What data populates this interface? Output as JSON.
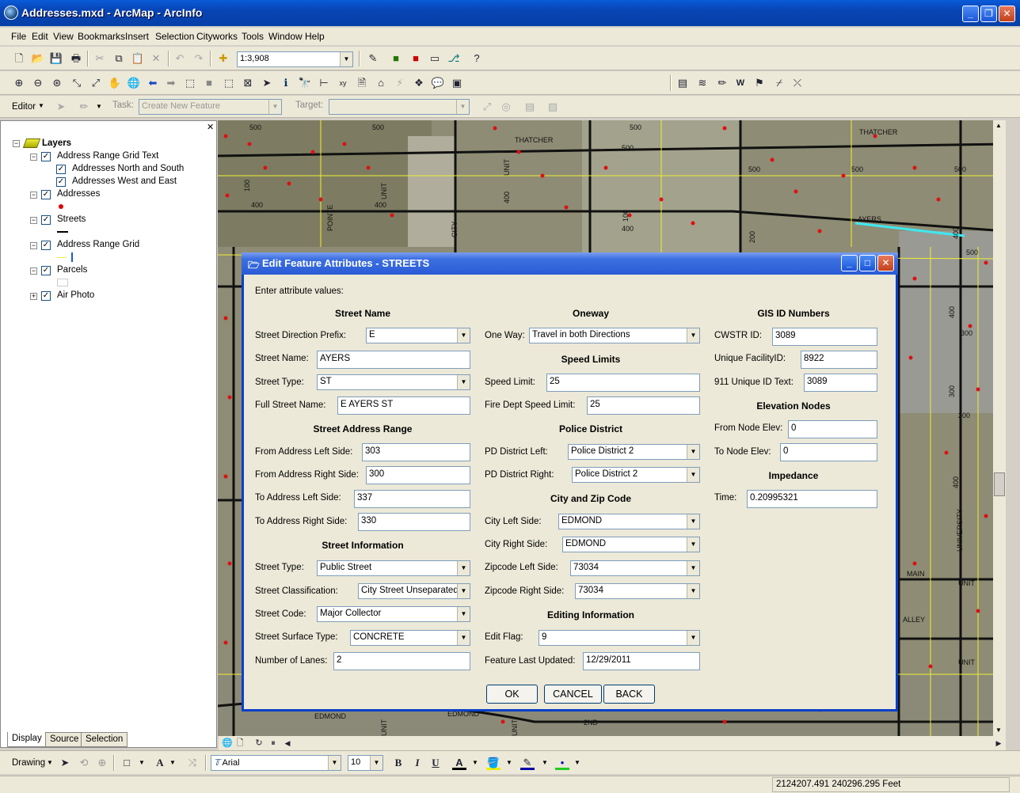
{
  "window": {
    "title": "Addresses.mxd - ArcMap - ArcInfo"
  },
  "menu": [
    "File",
    "Edit",
    "View",
    "Bookmarks",
    "Insert",
    "Selection",
    "Cityworks",
    "Tools",
    "Window",
    "Help"
  ],
  "toolbar": {
    "scale": "1:3,908"
  },
  "editor": {
    "label": "Editor",
    "task_label": "Task:",
    "task_value": "Create New Feature",
    "target_label": "Target:"
  },
  "toc": {
    "root": "Layers",
    "layers": [
      "Address Range Grid Text",
      "Addresses North and South",
      "Addresses West and East",
      "Addresses",
      "Streets",
      "Address Range Grid",
      "Parcels",
      "Air Photo"
    ],
    "tabs": [
      "Display",
      "Source",
      "Selection"
    ]
  },
  "map": {
    "labels": [
      "500",
      "500",
      "THATCHER",
      "500",
      "500",
      "THATCHER",
      "500",
      "500",
      "500",
      "400",
      "100",
      "400",
      "POINTE",
      "UNIT",
      "AYERS",
      "400",
      "400",
      "100",
      "400",
      "UNIT",
      "200",
      "500",
      "400",
      "300",
      "300",
      "200",
      "MAIN",
      "UNIT",
      "ALLEY",
      "UNIT",
      "400",
      "UNIVERSITY",
      "EDMOND",
      "EDMOND",
      "2ND",
      "UNIT",
      "UNIT",
      "CITY"
    ]
  },
  "dialog": {
    "title": "Edit Feature Attributes - STREETS",
    "intro": "Enter attribute values:",
    "col1": {
      "h_street_name": "Street Name",
      "dir_prefix_label": "Street Direction Prefix:",
      "dir_prefix": "E",
      "street_name_label": "Street Name:",
      "street_name": "AYERS",
      "street_type_label": "Street Type:",
      "street_type": "ST",
      "full_name_label": "Full Street Name:",
      "full_name": "E AYERS ST",
      "h_range": "Street Address Range",
      "from_left_label": "From Address Left Side:",
      "from_left": "303",
      "from_right_label": "From Address Right Side:",
      "from_right": "300",
      "to_left_label": "To Address Left Side:",
      "to_left": "337",
      "to_right_label": "To Address Right Side:",
      "to_right": "330",
      "h_info": "Street Information",
      "info_type_label": "Street Type:",
      "info_type": "Public Street",
      "class_label": "Street Classification:",
      "class": "City Street Unseparated",
      "code_label": "Street Code:",
      "code": "Major Collector",
      "surface_label": "Street Surface Type:",
      "surface": "CONCRETE",
      "lanes_label": "Number of Lanes:",
      "lanes": "2"
    },
    "col2": {
      "h_oneway": "Oneway",
      "oneway_label": "One Way:",
      "oneway": "Travel in both Directions",
      "h_speed": "Speed Limits",
      "speed_label": "Speed Limit:",
      "speed": "25",
      "fire_label": "Fire Dept Speed Limit:",
      "fire": "25",
      "h_police": "Police District",
      "pd_left_label": "PD District Left:",
      "pd_left": "Police District 2",
      "pd_right_label": "PD District Right:",
      "pd_right": "Police District 2",
      "h_city": "City and Zip Code",
      "city_left_label": "City Left Side:",
      "city_left": "EDMOND",
      "city_right_label": "City Right Side:",
      "city_right": "EDMOND",
      "zip_left_label": "Zipcode Left Side:",
      "zip_left": "73034",
      "zip_right_label": "Zipcode Right Side:",
      "zip_right": "73034",
      "h_edit": "Editing Information",
      "flag_label": "Edit Flag:",
      "flag": "9",
      "updated_label": "Feature Last Updated:",
      "updated": "12/29/2011"
    },
    "col3": {
      "h_gis": "GIS ID Numbers",
      "cwstr_label": "CWSTR ID:",
      "cwstr": "3089",
      "facility_label": "Unique FacilityID:",
      "facility": "8922",
      "e911_label": "911 Unique ID Text:",
      "e911": "3089",
      "h_elev": "Elevation Nodes",
      "from_elev_label": "From Node Elev:",
      "from_elev": "0",
      "to_elev_label": "To Node Elev:",
      "to_elev": "0",
      "h_imp": "Impedance",
      "time_label": "Time:",
      "time": "0.20995321"
    },
    "buttons": {
      "ok": "OK",
      "cancel": "CANCEL",
      "back": "BACK"
    }
  },
  "drawing": {
    "label": "Drawing",
    "font": "Arial",
    "size": "10",
    "bold": "B",
    "italic": "I",
    "underline": "U"
  },
  "status": {
    "coords": "2124207.491  240296.295 Feet"
  }
}
